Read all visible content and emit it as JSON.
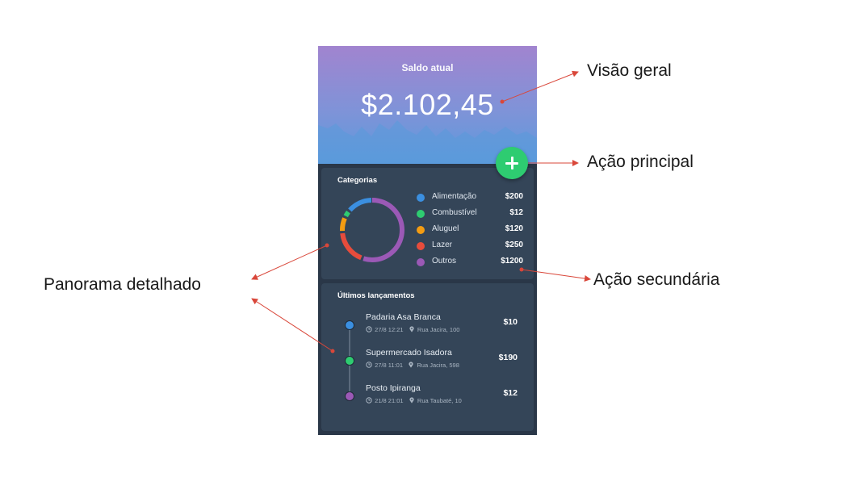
{
  "app": {
    "balance_label": "Saldo atual",
    "balance_value": "$2.102,45",
    "fab_icon": "plus-icon"
  },
  "categories": {
    "title": "Categorias",
    "items": [
      {
        "label": "Alimentação",
        "value": "$200",
        "color": "#3b8fe0"
      },
      {
        "label": "Combustível",
        "value": "$12",
        "color": "#2ecc71"
      },
      {
        "label": "Aluguel",
        "value": "$120",
        "color": "#f39c12"
      },
      {
        "label": "Lazer",
        "value": "$250",
        "color": "#e74c3c"
      },
      {
        "label": "Outros",
        "value": "$1200",
        "color": "#9b59b6"
      }
    ]
  },
  "transactions": {
    "title": "Últimos lançamentos",
    "items": [
      {
        "name": "Padaria Asa Branca",
        "datetime": "27/8 12:21",
        "location": "Rua Jacira, 100",
        "amount": "$10",
        "color": "#3b8fe0"
      },
      {
        "name": "Supermercado Isadora",
        "datetime": "27/8 11:01",
        "location": "Rua Jacira, 598",
        "amount": "$190",
        "color": "#2ecc71"
      },
      {
        "name": "Posto Ipiranga",
        "datetime": "21/8 21:01",
        "location": "Rua Taubaté, 10",
        "amount": "$12",
        "color": "#9b59b6"
      }
    ]
  },
  "annotations": {
    "overview": "Visão geral",
    "primary_action": "Ação principal",
    "secondary_action": "Ação secundária",
    "detailed_panorama": "Panorama detalhado",
    "arrow_color": "#d9473a"
  }
}
